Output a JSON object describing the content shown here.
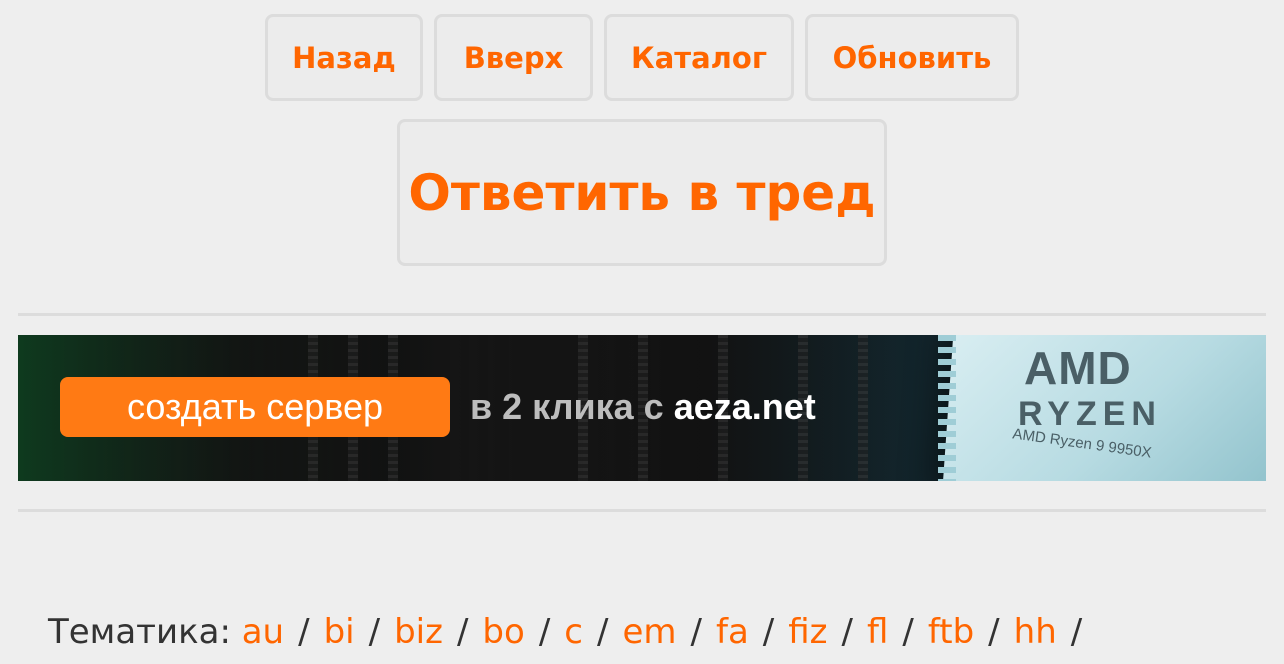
{
  "nav": {
    "back_label": "Назад",
    "up_label": "Вверх",
    "catalog_label": "Каталог",
    "refresh_label": "Обновить"
  },
  "reply": {
    "label": "Ответить в тред"
  },
  "banner": {
    "cta_label": "создать сервер",
    "text_prefix": "в 2 клика с",
    "text_domain": "aeza.net",
    "chip_brand": "AMD",
    "chip_line": "RYZEN",
    "chip_model": "AMD Ryzen 9 9950X"
  },
  "topics": {
    "label": "Тематика:",
    "boards": [
      "au",
      "bi",
      "biz",
      "bo",
      "c",
      "em",
      "fa",
      "fiz",
      "fl",
      "ftb",
      "hh"
    ]
  },
  "colors": {
    "accent": "#ff6600",
    "background": "#eeeeee",
    "border": "#dcdcdc",
    "cta": "#ff7a14"
  }
}
